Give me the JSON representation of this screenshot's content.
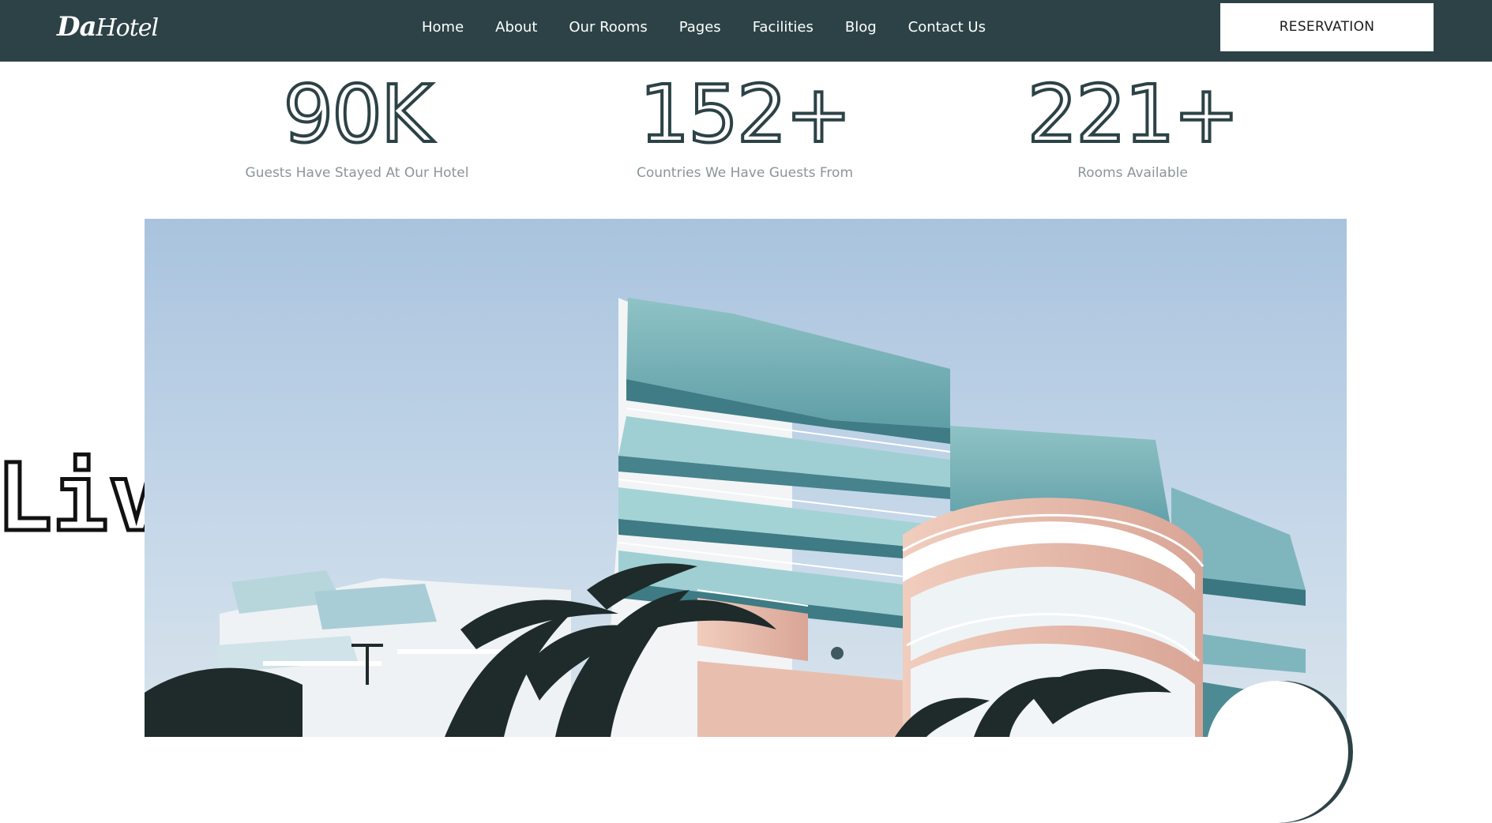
{
  "header": {
    "logo_main": "Da",
    "logo_second": "Hotel",
    "nav": [
      "Home",
      "About",
      "Our Rooms",
      "Pages",
      "Facilities",
      "Blog",
      "Contact Us"
    ],
    "reserve_label": "RESERVATION"
  },
  "stats": [
    {
      "number": "90K",
      "label": "Guests Have Stayed At Our Hotel"
    },
    {
      "number": "152+",
      "label": "Countries We Have Guests From"
    },
    {
      "number": "221+",
      "label": "Rooms Available"
    }
  ],
  "marquee": {
    "text": "Living in Hote"
  },
  "colors": {
    "header_bg": "#2c4247",
    "accent_dark": "#2c4247",
    "stat_label": "#8a959a",
    "white": "#ffffff"
  }
}
